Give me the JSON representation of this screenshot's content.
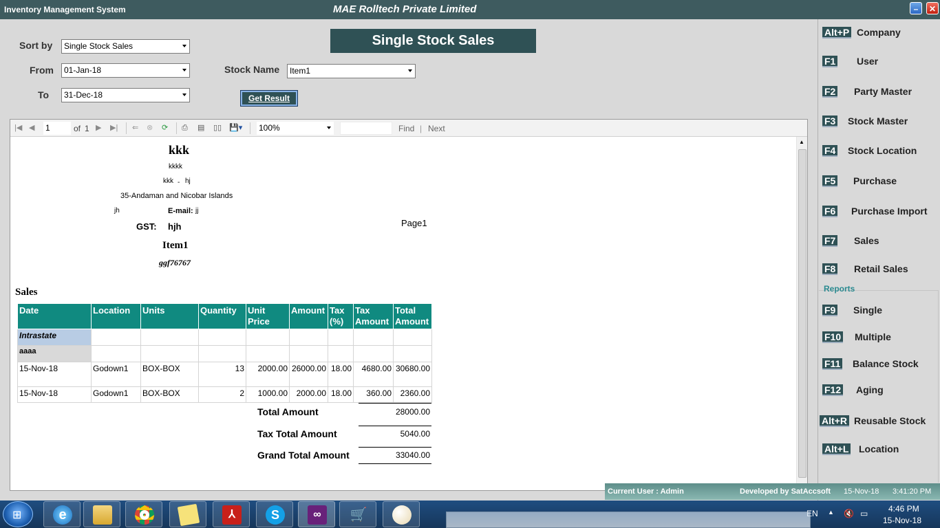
{
  "window": {
    "app_title": "Inventory Management System",
    "company_title": "MAE Rolltech Private Limited"
  },
  "form": {
    "sort_by_label": "Sort by",
    "sort_by_value": "Single Stock Sales",
    "from_label": "From",
    "from_value": "01-Jan-18",
    "to_label": "To",
    "to_value": "31-Dec-18",
    "stock_name_label": "Stock Name",
    "stock_name_value": "Item1",
    "heading": "Single Stock Sales",
    "get_result_label": "Get Result"
  },
  "viewer_toolbar": {
    "page_number": "1",
    "of_label": "of",
    "page_count": "1",
    "zoom": "100%",
    "find_label": "Find",
    "separator": "|",
    "next_label": "Next"
  },
  "report": {
    "company_name": "kkk",
    "line1": "kkkk",
    "line2a": "kkk",
    "line2_sep": "-",
    "line2b": "hj",
    "state": "35-Andaman and Nicobar Islands",
    "phone": "jh",
    "email_label": "E-mail:",
    "email_value": "jj",
    "gst_label": "GST:",
    "gst_value": "hjh",
    "item_name": "Item1",
    "item_code": "ggf76767",
    "page_label": "Page1",
    "section_title": "Sales",
    "columns": [
      "Date",
      "Location",
      "Units",
      "Quantity",
      "Unit Price",
      "Amount",
      "Tax (%)",
      "Tax Amount",
      "Total Amount"
    ],
    "group_label": "Intrastate",
    "party_label": "aaaa",
    "rows": [
      [
        "15-Nov-18",
        "Godown1",
        "BOX-BOX",
        "13",
        "2000.00",
        "26000.00",
        "18.00",
        "4680.00",
        "30680.00"
      ],
      [
        "15-Nov-18",
        "Godown1",
        "BOX-BOX",
        "2",
        "1000.00",
        "2000.00",
        "18.00",
        "360.00",
        "2360.00"
      ]
    ],
    "total_amount_label": "Total Amount",
    "total_amount_value": "28000.00",
    "tax_total_label": "Tax Total Amount",
    "tax_total_value": "5040.00",
    "grand_total_label": "Grand Total Amount",
    "grand_total_value": "33040.00"
  },
  "menu": {
    "items": [
      {
        "key": "Alt+P",
        "label": "Company"
      },
      {
        "key": "F1",
        "label": "User"
      },
      {
        "key": "F2",
        "label": "Party Master"
      },
      {
        "key": "F3",
        "label": "Stock Master"
      },
      {
        "key": "F4",
        "label": "Stock Location"
      },
      {
        "key": "F5",
        "label": "Purchase"
      },
      {
        "key": "F6",
        "label": "Purchase Import"
      },
      {
        "key": "F7",
        "label": "Sales"
      },
      {
        "key": "F8",
        "label": "Retail Sales"
      }
    ],
    "reports_heading": "Reports",
    "report_items": [
      {
        "key": "F9",
        "label": "Single"
      },
      {
        "key": "F10",
        "label": "Multiple"
      },
      {
        "key": "F11",
        "label": "Balance Stock"
      },
      {
        "key": "F12",
        "label": "Aging"
      },
      {
        "key": "Alt+R",
        "label": "Reusable Stock"
      },
      {
        "key": "Alt+L",
        "label": "Location"
      }
    ]
  },
  "status": {
    "current_user": "Current User : Admin",
    "developed_by": "Developed by SatAccsoft",
    "date": "15-Nov-18",
    "time": "3:41:20 PM"
  },
  "taskbar": {
    "language": "EN",
    "time": "4:46 PM",
    "date": "15-Nov-18"
  },
  "colors": {
    "titlebar": "#3e5b5f",
    "accent_dark": "#2f5155",
    "table_header": "#108a80",
    "reports_heading": "#2a8a90"
  }
}
